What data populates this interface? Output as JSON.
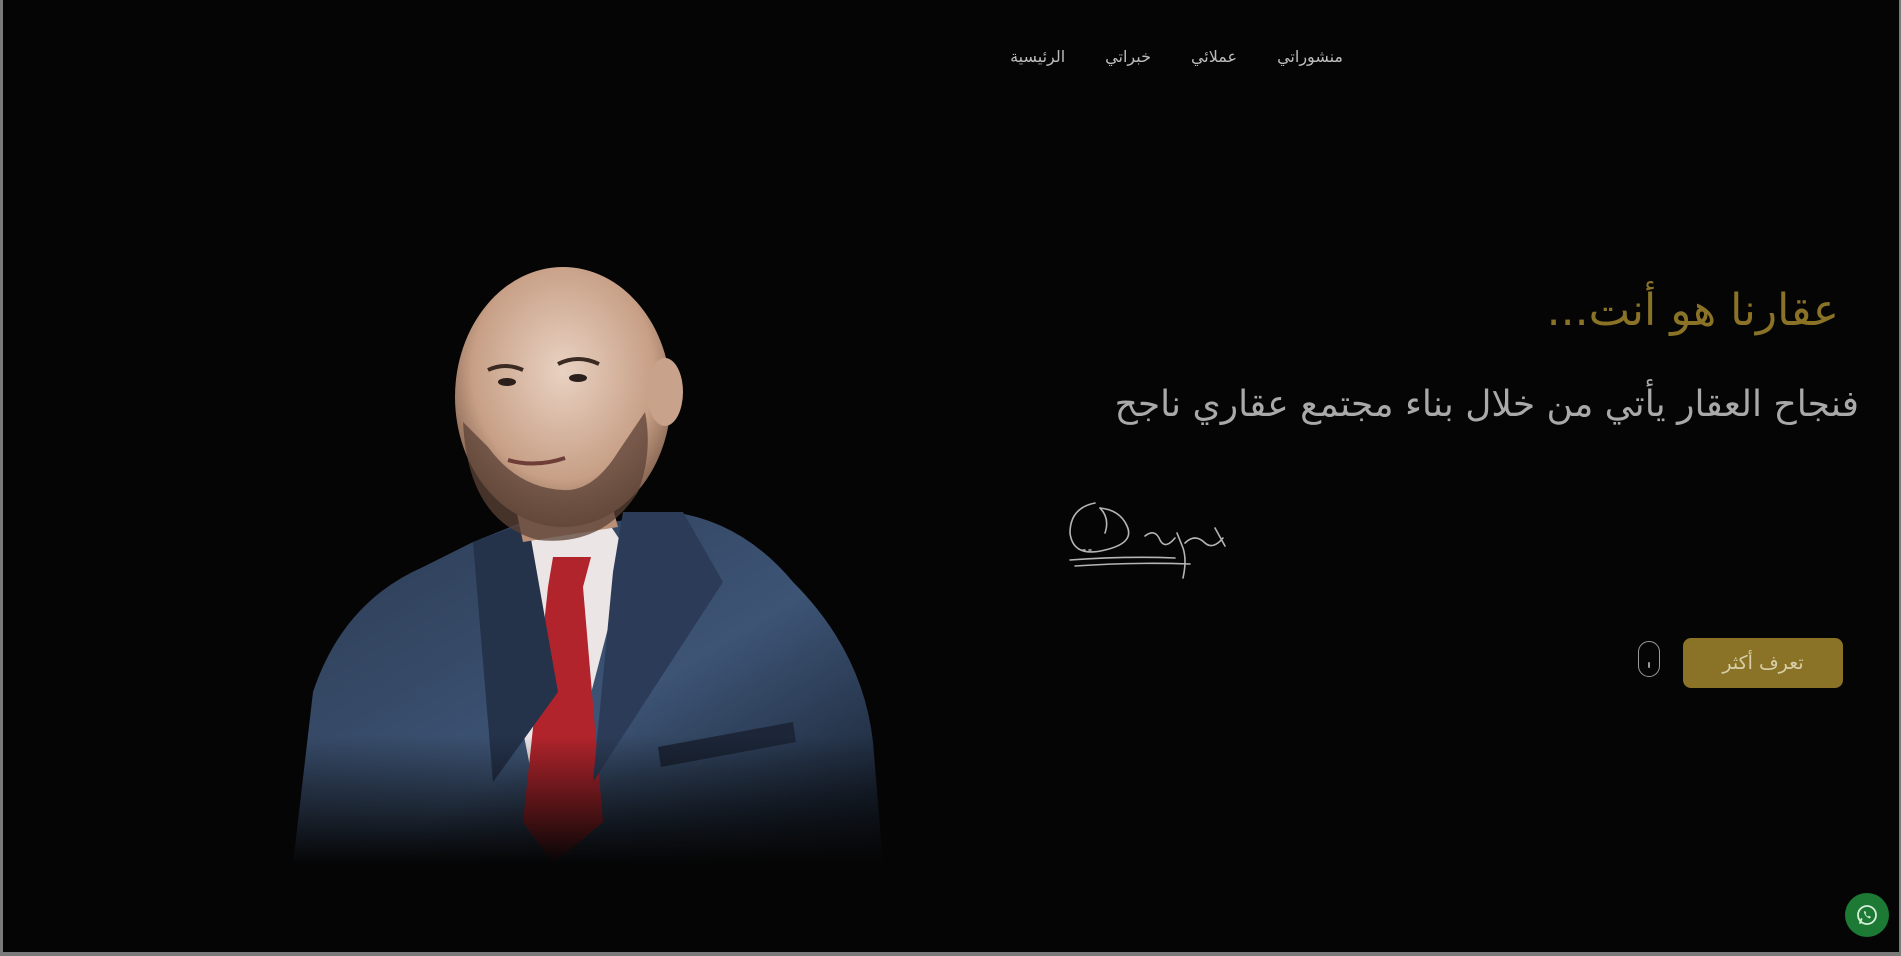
{
  "nav": {
    "items": [
      {
        "label": "منشوراتي"
      },
      {
        "label": "عملائي"
      },
      {
        "label": "خبراتي"
      },
      {
        "label": "الرئيسية"
      }
    ]
  },
  "hero": {
    "headline": "عقارنا هو أنت...",
    "subline": "فنجاح العقار يأتي من خلال بناء مجتمع عقاري ناجح",
    "cta_label": "تعرف أكثر",
    "portrait_subject": "man-in-navy-suit-red-tie"
  },
  "icons": {
    "scroll": "mouse-scroll-icon",
    "whatsapp": "whatsapp-icon"
  },
  "colors": {
    "accent_gold": "#8a7326",
    "background": "#050505",
    "text_muted": "#a9a9a9",
    "whatsapp_green": "#1d7a34"
  }
}
